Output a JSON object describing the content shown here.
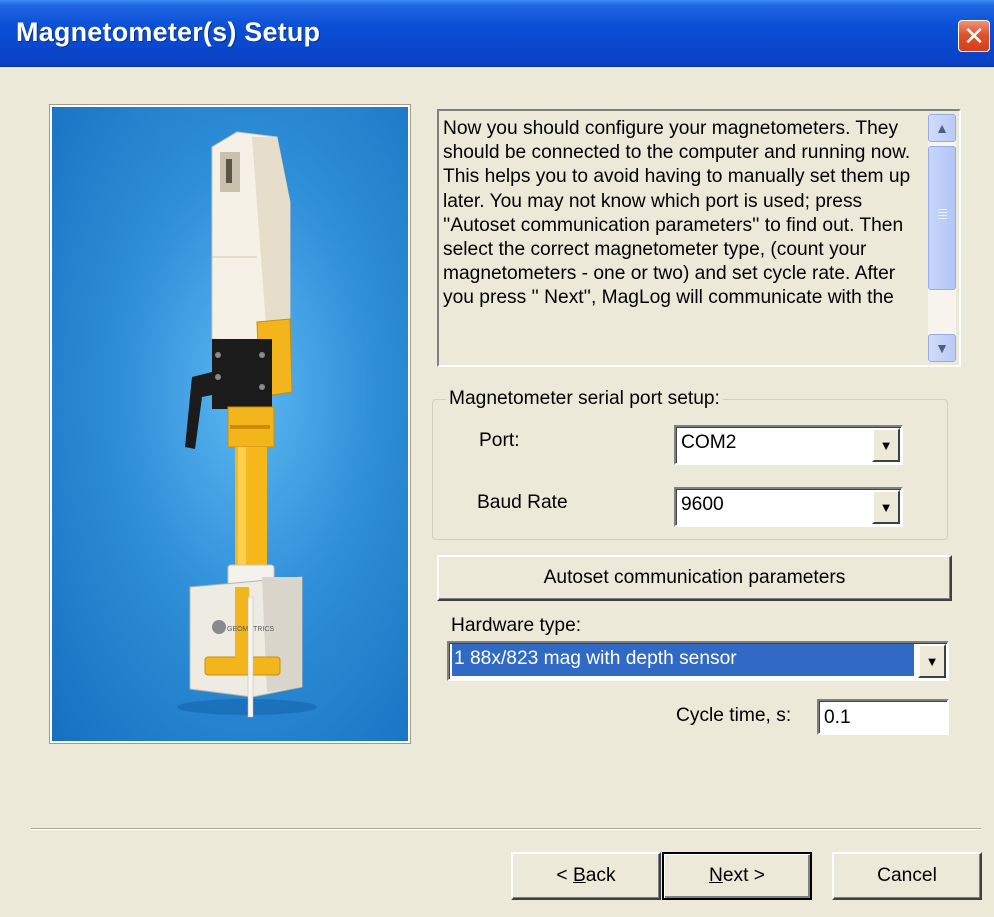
{
  "window": {
    "title": "Magnetometer(s) Setup",
    "close_glyph": "✕"
  },
  "photo": {
    "alt": "Magnetometer sensor photo",
    "logo_text": "GEOMETRICS"
  },
  "description": {
    "text": "Now you should configure your magnetometers. They should be connected to the computer and running now. This helps you to avoid having to manually set them up later. You may not know which port is used; press ''Autoset communication parameters'' to find out. Then select the correct magnetometer type, (count your magnetometers - one or two) and set cycle rate. After you press '' Next'',  MagLog will communicate with the"
  },
  "serial_setup": {
    "legend": "Magnetometer serial port setup:",
    "port_label": "Port:",
    "port_value": "COM2",
    "baud_label": "Baud Rate",
    "baud_value": "9600"
  },
  "autoset_label": "Autoset communication parameters",
  "hardware": {
    "label": "Hardware type:",
    "value": "1 88x/823 mag with depth sensor"
  },
  "cycle": {
    "label": "Cycle time, s:",
    "value": "0.1"
  },
  "buttons": {
    "back_prefix": "< ",
    "back_accel": "B",
    "back_rest": "ack",
    "next_accel": "N",
    "next_rest": "ext >",
    "cancel": "Cancel"
  },
  "icons": {
    "dropdown": "▼",
    "scroll_up": "▲",
    "scroll_down": "▼"
  },
  "colors": {
    "titlebar": "#0a4fd6",
    "selection": "#316ac5",
    "dialog_bg": "#ece9d8"
  }
}
